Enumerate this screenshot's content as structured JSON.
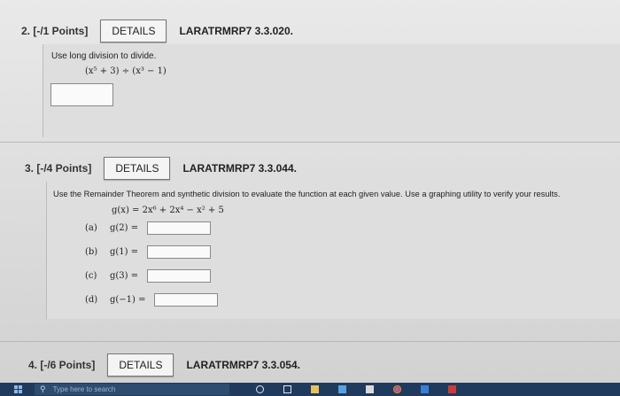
{
  "questions": [
    {
      "number": "2. [-/1 Points]",
      "details_label": "DETAILS",
      "code": "LARATRMRP7 3.3.020.",
      "prompt": "Use long division to divide.",
      "expression": "(x⁵ + 3) ÷ (x³ − 1)"
    },
    {
      "number": "3. [-/4 Points]",
      "details_label": "DETAILS",
      "code": "LARATRMRP7 3.3.044.",
      "prompt": "Use the Remainder Theorem and synthetic division to evaluate the function at each given value. Use a graphing utility to verify your results.",
      "function": "g(x) = 2x⁶ + 2x⁴ − x² + 5",
      "parts": [
        {
          "label": "(a)",
          "expr": "g(2) ="
        },
        {
          "label": "(b)",
          "expr": "g(1) ="
        },
        {
          "label": "(c)",
          "expr": "g(3) ="
        },
        {
          "label": "(d)",
          "expr": "g(−1) ="
        }
      ]
    },
    {
      "number": "4. [-/6 Points]",
      "details_label": "DETAILS",
      "code": "LARATRMRP7 3.3.054."
    }
  ],
  "taskbar": {
    "search_placeholder": "Type here to search"
  },
  "colors": {
    "taskbar": "#1f3a5c",
    "page": "#e5e5e5"
  }
}
